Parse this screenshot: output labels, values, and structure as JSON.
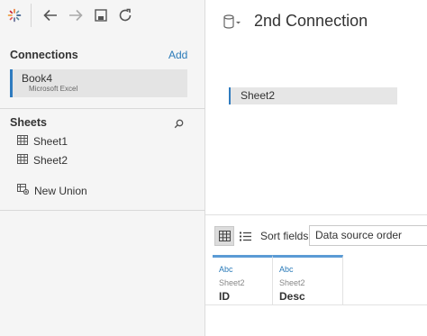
{
  "connection_title": "2nd Connection",
  "connections_pane": {
    "title": "Connections",
    "add_label": "Add",
    "items": [
      {
        "name": "Book4",
        "type": "Microsoft Excel"
      }
    ]
  },
  "sheets_pane": {
    "title": "Sheets",
    "items": [
      {
        "label": "Sheet1"
      },
      {
        "label": "Sheet2"
      }
    ],
    "new_union_label": "New Union"
  },
  "canvas": {
    "tables": [
      {
        "label": "Sheet2"
      }
    ]
  },
  "grid_toolbar": {
    "sort_label": "Sort fields",
    "sort_value": "Data source order"
  },
  "fields": [
    {
      "type": "Abc",
      "source": "Sheet2",
      "name": "ID"
    },
    {
      "type": "Abc",
      "source": "Sheet2",
      "name": "Desc"
    }
  ],
  "colors": {
    "accent": "#2f7bbf",
    "link": "#2b7bb9",
    "left_pane_bg": "#f5f5f5"
  },
  "icons": {
    "logo": "tableau-logo-icon",
    "back": "back-arrow-icon",
    "forward": "forward-arrow-icon",
    "save": "save-icon",
    "refresh": "refresh-icon",
    "datasource": "database-icon",
    "search": "search-icon",
    "sheet": "sheet-grid-icon",
    "union": "union-icon",
    "grid_view": "grid-view-icon",
    "list_view": "list-view-icon"
  }
}
